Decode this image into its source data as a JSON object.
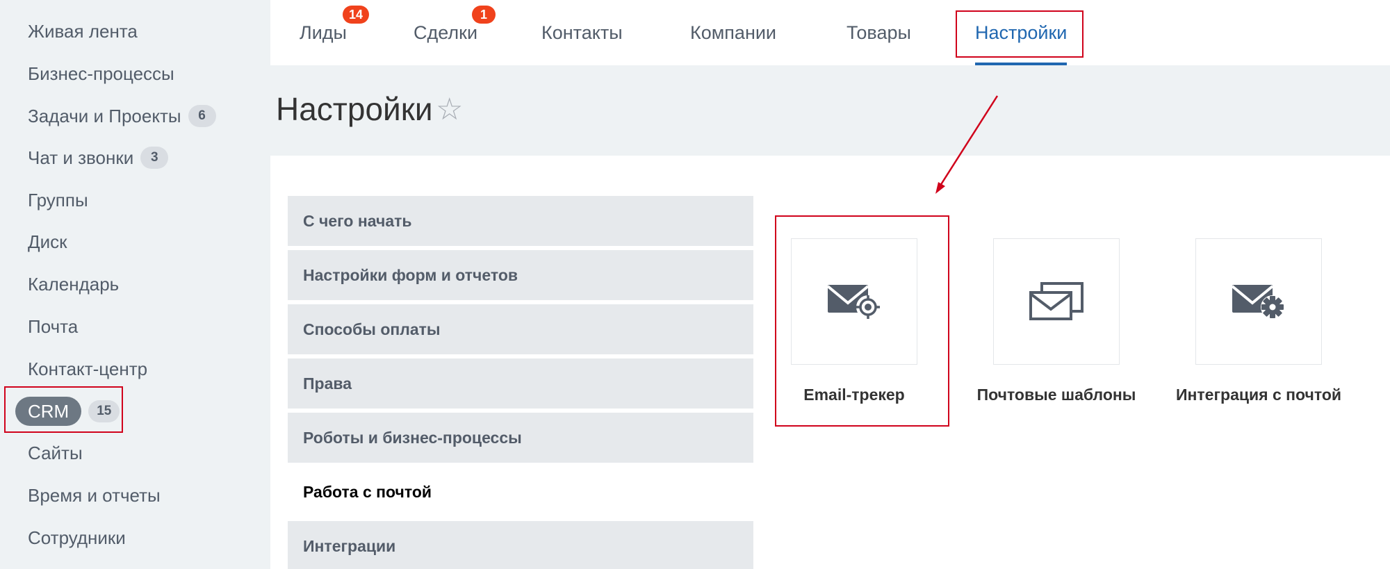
{
  "sidebar": {
    "items": [
      {
        "label": "Живая лента"
      },
      {
        "label": "Бизнес-процессы"
      },
      {
        "label": "Задачи и Проекты",
        "badge": "6"
      },
      {
        "label": "Чат и звонки",
        "badge": "3"
      },
      {
        "label": "Группы"
      },
      {
        "label": "Диск"
      },
      {
        "label": "Календарь"
      },
      {
        "label": "Почта"
      },
      {
        "label": "Контакт-центр"
      },
      {
        "label": "CRM",
        "badge": "15",
        "active": true
      },
      {
        "label": "Сайты"
      },
      {
        "label": "Время и отчеты"
      },
      {
        "label": "Сотрудники"
      }
    ]
  },
  "tabs": [
    {
      "label": "Лиды",
      "counter": "14"
    },
    {
      "label": "Сделки",
      "counter": "1"
    },
    {
      "label": "Контакты"
    },
    {
      "label": "Компании"
    },
    {
      "label": "Товары"
    },
    {
      "label": "Настройки",
      "active": true
    }
  ],
  "page": {
    "title": "Настройки",
    "star": "☆"
  },
  "menu": [
    {
      "label": "С чего начать"
    },
    {
      "label": "Настройки форм и отчетов"
    },
    {
      "label": "Способы оплаты"
    },
    {
      "label": "Права"
    },
    {
      "label": "Роботы и бизнес-процессы"
    },
    {
      "label": "Работа с почтой",
      "active": true
    },
    {
      "label": "Интеграции"
    }
  ],
  "tiles": [
    {
      "label": "Email-трекер",
      "icon": "email-tracker-icon"
    },
    {
      "label": "Почтовые шаблоны",
      "icon": "mail-templates-icon"
    },
    {
      "label": "Интеграция с почтой",
      "icon": "mail-settings-icon"
    }
  ],
  "colors": {
    "accent": "#2067b0",
    "counter": "#f0421c",
    "annotation": "#d0021b",
    "icon": "#535c69"
  }
}
